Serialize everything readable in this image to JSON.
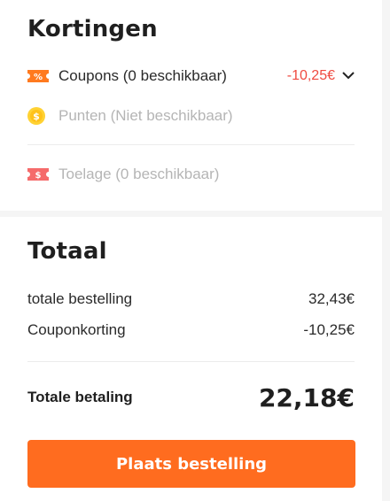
{
  "discounts": {
    "title": "Kortingen",
    "coupons": {
      "label": "Coupons (0 beschikbaar)",
      "value": "-10,25€",
      "icon": "coupon-icon"
    },
    "points": {
      "label": "Punten (Niet beschikbaar)",
      "icon": "coin-icon"
    },
    "allowance": {
      "label": "Toelage (0 beschikbaar)",
      "icon": "allowance-ticket-icon"
    }
  },
  "total": {
    "title": "Totaal",
    "order_label": "totale bestelling",
    "order_value": "32,43€",
    "coupon_label": "Couponkorting",
    "coupon_value": "-10,25€",
    "payment_label": "Totale betaling",
    "payment_value": "22,18€",
    "place_order": "Plaats bestelling"
  },
  "colors": {
    "accent": "#ff6c1f",
    "discount": "#ef4a40",
    "disabled_text": "#b5b5b5"
  }
}
